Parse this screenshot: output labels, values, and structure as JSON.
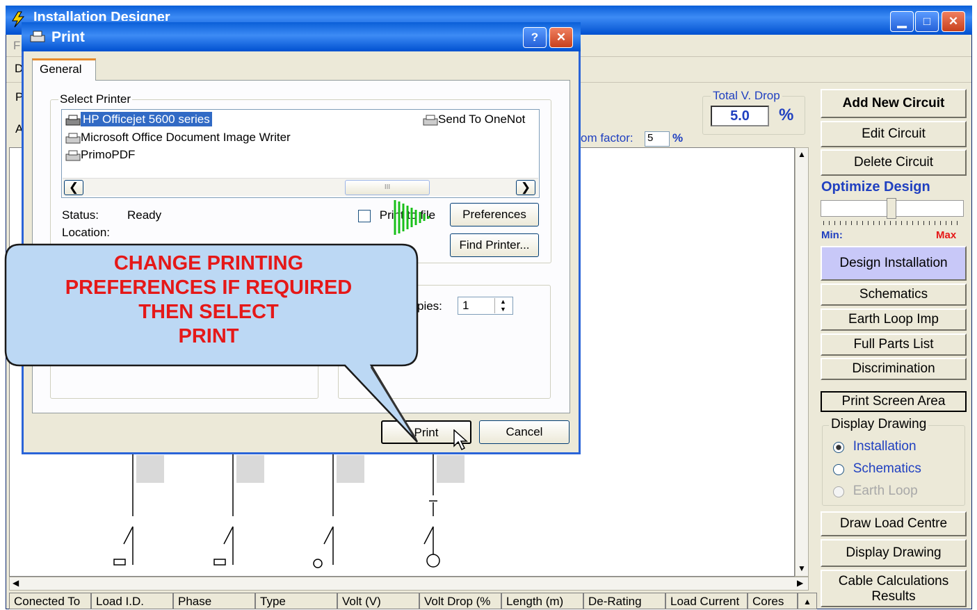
{
  "main_window": {
    "title": "Installation Designer",
    "menu_first": "F",
    "tool_first": "D",
    "left_letters": [
      "P",
      "A"
    ]
  },
  "voltage_drop": {
    "group_label": "Total V. Drop",
    "value": "5.0",
    "unit": "%"
  },
  "zoom": {
    "label": "om factor:",
    "value": "5",
    "unit": "%"
  },
  "right_panel": {
    "add_new_circuit": "Add New Circuit",
    "edit_circuit": "Edit Circuit",
    "delete_circuit": "Delete Circuit",
    "optimize_design": "Optimize Design",
    "slider_min": "Min:",
    "slider_max": "Max",
    "design_installation": "Design Installation",
    "schematics": "Schematics",
    "earth_loop_imp": "Earth Loop Imp",
    "full_parts_list": "Full Parts List",
    "discrimination": "Discrimination",
    "print_screen_area": "Print Screen Area",
    "display_drawing_group": "Display Drawing",
    "radio_installation": "Installation",
    "radio_schematics": "Schematics",
    "radio_earth_loop": "Earth Loop",
    "draw_load_centre": "Draw Load Centre",
    "display_drawing_button": "Display Drawing",
    "cable_calc_line1": "Cable Calculations",
    "cable_calc_line2": "Results"
  },
  "column_headers": [
    "Conected To",
    "Load I.D.",
    "Phase",
    "Type",
    "Volt (V)",
    "Volt Drop (%",
    "Length (m)",
    "De-Rating",
    "Load Current",
    "Cores"
  ],
  "print_dialog": {
    "title": "Print",
    "help": "?",
    "close": "✕",
    "tab_general": "General",
    "select_printer_label": "Select Printer",
    "printers": [
      "HP Officejet 5600 series",
      "Microsoft Office Document Image Writer",
      "PrimoPDF"
    ],
    "printer_right": "Send To OneNot",
    "status_label": "Status:",
    "status_value": "Ready",
    "location_label": "Location:",
    "print_to_file": "Print to file",
    "preferences": "Preferences",
    "find_printer": "Find Printer...",
    "copies_label": "pies:",
    "copies_value": "1",
    "print_button": "Print",
    "cancel_button": "Cancel"
  },
  "callout": {
    "lines": [
      "CHANGE PRINTING",
      "PREFERENCES IF REQUIRED",
      "THEN SELECT",
      "PRINT"
    ],
    "color": "#e51818"
  },
  "colors": {
    "titlebar": "#0a5fd8",
    "window_bg": "#ece9d8",
    "callout_fill": "#bcd8f4",
    "accent_blue": "#2040c0"
  }
}
